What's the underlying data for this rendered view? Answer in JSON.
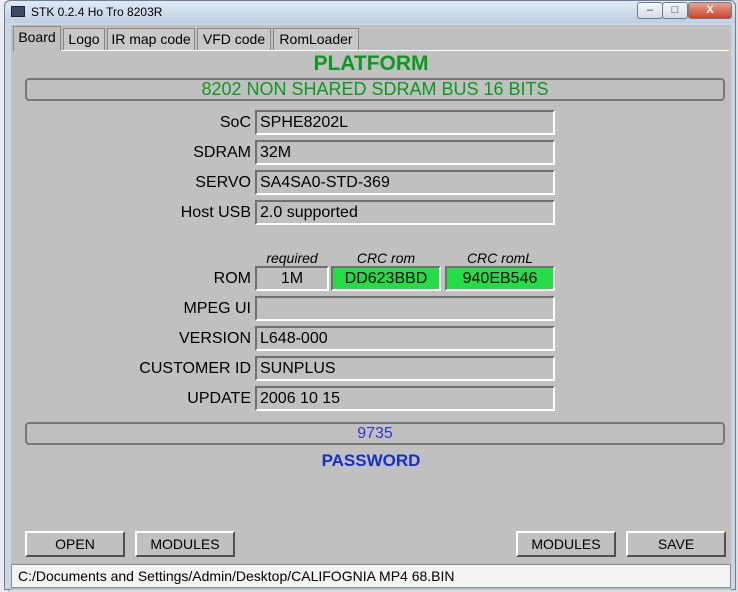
{
  "window": {
    "title": "STK 0.2.4 Ho Tro 8203R",
    "close_glyph": "X",
    "minimize_glyph": "–",
    "maximize_glyph": "□"
  },
  "tabs": [
    "Board",
    "Logo",
    "IR map code",
    "VFD code",
    "RomLoader"
  ],
  "platform": {
    "heading": "PLATFORM",
    "description": "8202 NON SHARED SDRAM BUS 16 BITS"
  },
  "fields": {
    "soc": {
      "label": "SoC",
      "value": "SPHE8202L"
    },
    "sdram": {
      "label": "SDRAM",
      "value": "32M"
    },
    "servo": {
      "label": "SERVO",
      "value": "SA4SA0-STD-369"
    },
    "host_usb": {
      "label": "Host USB",
      "value": "2.0 supported"
    },
    "mpeg_ui": {
      "label": "MPEG UI",
      "value": ""
    },
    "version": {
      "label": "VERSION",
      "value": "L648-000"
    },
    "customer_id": {
      "label": "CUSTOMER ID",
      "value": "SUNPLUS"
    },
    "update": {
      "label": "UPDATE",
      "value": "2006 10 15"
    }
  },
  "rom": {
    "label": "ROM",
    "required_caption": "required",
    "crc_rom_caption": "CRC rom",
    "crc_roml_caption": "CRC romL",
    "required": "1M",
    "crc_rom": "DD623BBD",
    "crc_roml": "940EB546",
    "ok_color": "#22dd44"
  },
  "password": {
    "value": "9735",
    "label": "PASSWORD"
  },
  "buttons": {
    "open": "OPEN",
    "modules_left": "MODULES",
    "modules_right": "MODULES",
    "save": "SAVE"
  },
  "status": {
    "path": "C:/Documents and Settings/Admin/Desktop/CALIFOGNIA MP4 68.BIN"
  },
  "colors": {
    "platform_green": "#0b9a1e",
    "password_blue": "#1530c8",
    "client_gray": "#c0c0c0"
  }
}
